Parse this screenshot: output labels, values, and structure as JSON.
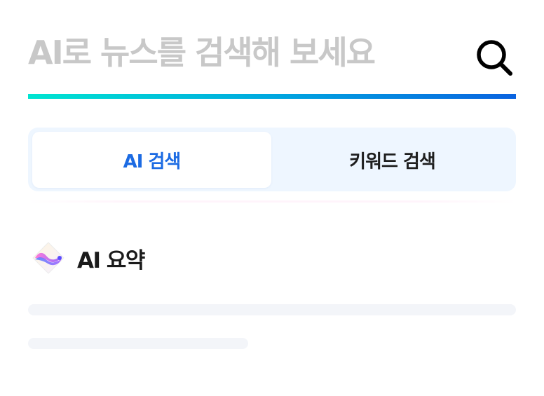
{
  "search": {
    "placeholder": "AI로 뉴스를 검색해 보세요",
    "value": "",
    "button_icon": "search-icon"
  },
  "theme": {
    "accent": "#1c6be3",
    "gradient_start": "#00e5d1",
    "gradient_end": "#0a63e0",
    "tab_bar_bg": "#eef6ff",
    "skeleton": "#f3f5f9"
  },
  "tabs": [
    {
      "label": "AI 검색",
      "selected": true
    },
    {
      "label": "키워드 검색",
      "selected": false
    }
  ],
  "summary": {
    "icon": "ai-summary-icon",
    "title": "AI 요약",
    "loading_lines": 2
  }
}
